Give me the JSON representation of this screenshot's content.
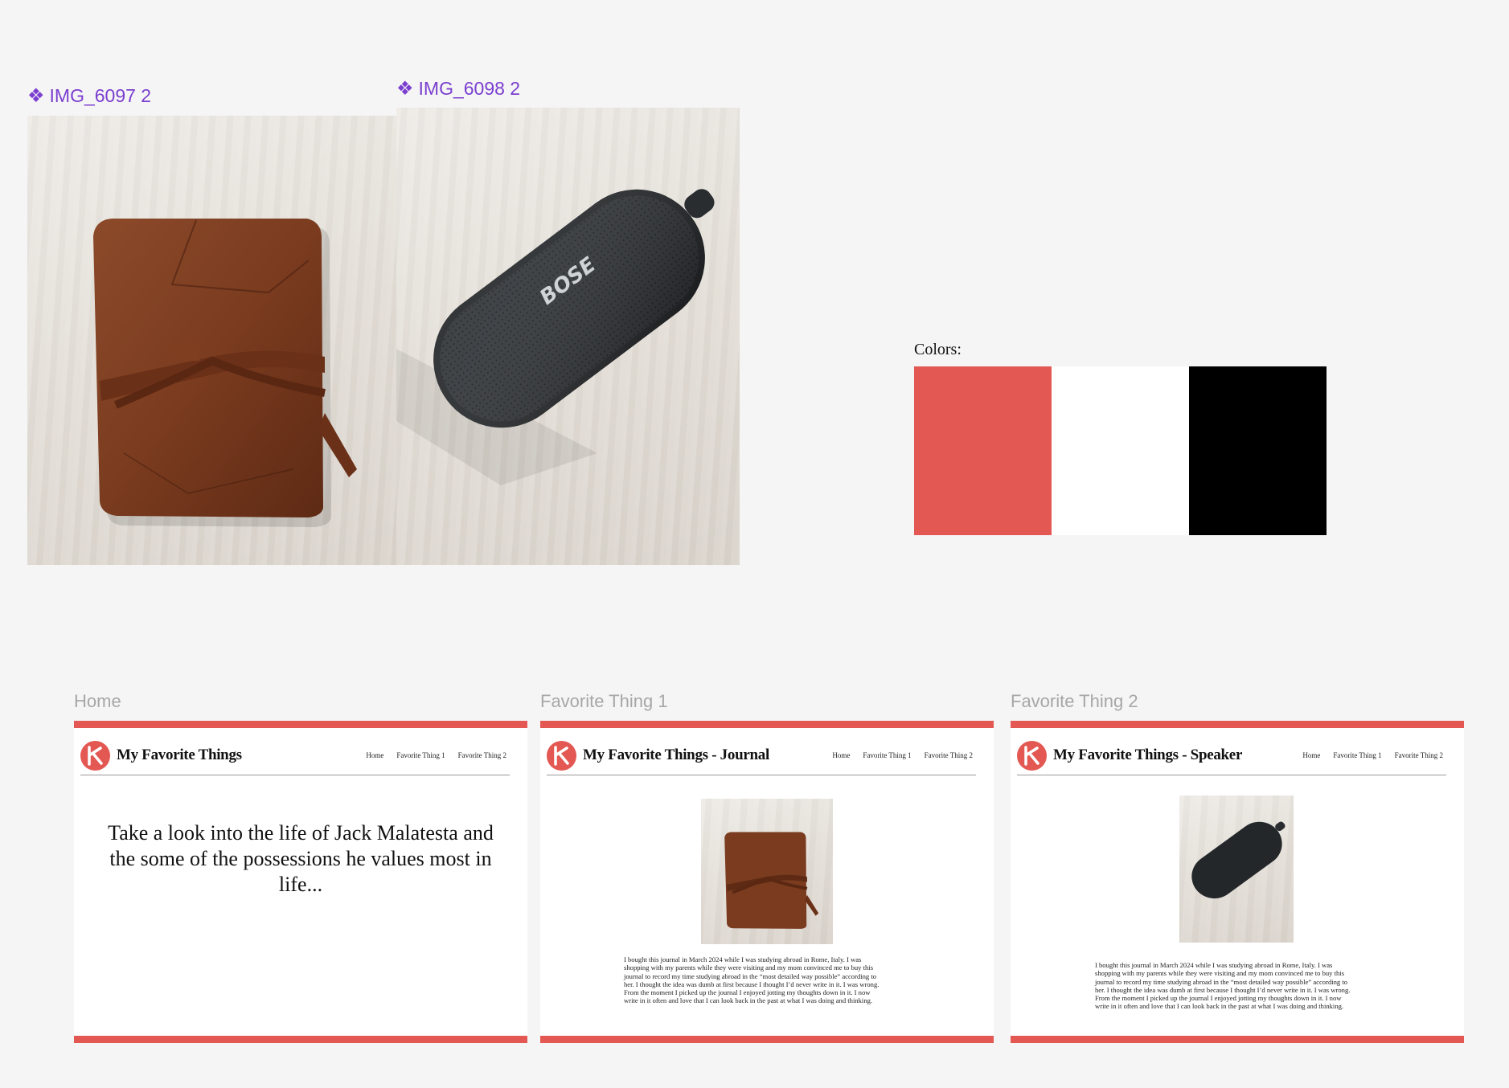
{
  "assets": [
    {
      "label": "IMG_6097 2",
      "icon": "component-diamond-icon",
      "subject": "leather journal"
    },
    {
      "label": "IMG_6098 2",
      "icon": "component-diamond-icon",
      "subject": "speaker"
    }
  ],
  "palette": {
    "label": "Colors:",
    "swatches": [
      "#E35852",
      "#FFFFFF",
      "#000000"
    ]
  },
  "frames": [
    {
      "frame_label": "Home",
      "site_title": "My Favorite Things",
      "nav": [
        "Home",
        "Favorite Thing 1",
        "Favorite Thing 2"
      ],
      "hero": "Take a look into the life of Jack Malatesta and the some of the possessions he values most in life..."
    },
    {
      "frame_label": "Favorite Thing 1",
      "site_title": "My Favorite Things - Journal",
      "nav": [
        "Home",
        "Favorite Thing 1",
        "Favorite Thing 2"
      ],
      "body_lines": [
        "I bought this journal in March 2024 while I was studying abroad in Rome, Italy. I was",
        "shopping with my parents while they were visiting and my mom convinced me to buy this",
        "journal to record my time studying abroad in the “most detailed way possible” according to",
        "her. I thought the idea was dumb at first because I thought I’d never write in it. I was wrong.",
        "From the moment I picked up the journal  I enjoyed jotting my thoughts down in it. I now",
        "write in it often and love that I can look back in the past at what I was doing and thinking."
      ]
    },
    {
      "frame_label": "Favorite Thing 2",
      "site_title": "My Favorite Things - Speaker",
      "nav": [
        "Home",
        "Favorite Thing 1",
        "Favorite Thing 2"
      ],
      "body_lines": [
        "I bought this journal in March 2024 while I was studying abroad in Rome, Italy. I was",
        "shopping with my parents while they were visiting and my mom convinced me to buy this",
        "journal to record my time studying abroad in the “most detailed way possible” according to",
        "her. I thought the idea was dumb at first because I thought I’d never write in it. I was wrong.",
        "From the moment I picked up the journal  I enjoyed jotting my thoughts down in it. I now",
        "write in it often and love that I can look back in the past at what I was doing and thinking."
      ]
    }
  ],
  "speaker_brand": "BOSE",
  "colors": {
    "accent": "#E35852",
    "component_purple": "#7B3FD0",
    "frame_label_gray": "#A7A7A7",
    "canvas": "#F5F5F5"
  }
}
